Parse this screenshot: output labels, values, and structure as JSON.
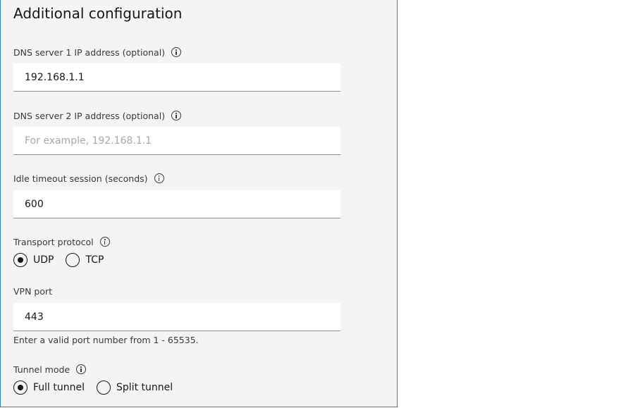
{
  "panel": {
    "title": "Additional configuration"
  },
  "dns1": {
    "label": "DNS server 1 IP address (optional)",
    "value": "192.168.1.1",
    "placeholder": ""
  },
  "dns2": {
    "label": "DNS server 2 IP address (optional)",
    "value": "",
    "placeholder": "For example, 192.168.1.1"
  },
  "idle_timeout": {
    "label": "Idle timeout session (seconds)",
    "value": "600"
  },
  "transport": {
    "label": "Transport protocol",
    "options": [
      "UDP",
      "TCP"
    ],
    "selected": "UDP"
  },
  "vpn_port": {
    "label": "VPN port",
    "value": "443",
    "helper": "Enter a valid port number from 1 - 65535."
  },
  "tunnel": {
    "label": "Tunnel mode",
    "options": [
      "Full tunnel",
      "Split tunnel"
    ],
    "selected": "Full tunnel"
  },
  "icons": {
    "info": "info-icon",
    "radio_checked": "radio-checked-icon",
    "radio_unchecked": "radio-unchecked-icon"
  },
  "colors": {
    "panel_background": "#f4f4f4",
    "panel_border": "#2f7fc1",
    "input_background": "#ffffff",
    "input_underline": "#8d8d8d",
    "placeholder": "#a8a8a8",
    "text": "#161616"
  }
}
